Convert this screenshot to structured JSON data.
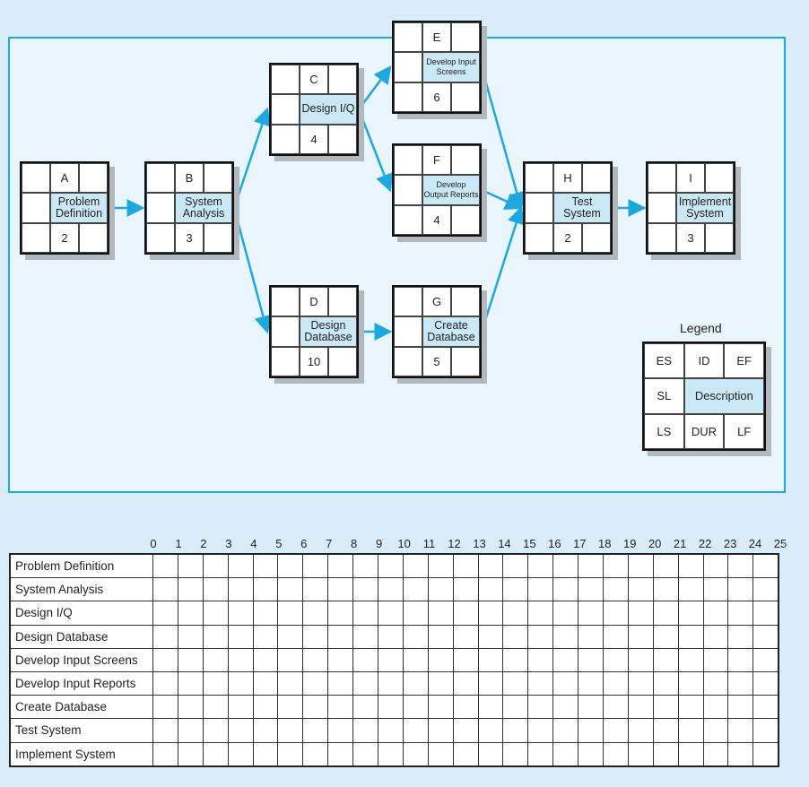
{
  "colors": {
    "accent": "#1ea8e0",
    "description_fill": "#cbe8f7",
    "frame_fill": "#e9f6fd",
    "background": "#d8edf9"
  },
  "nodes": [
    {
      "id": "A",
      "description": "Problem Definition",
      "duration": "2"
    },
    {
      "id": "B",
      "description": "System Analysis",
      "duration": "3"
    },
    {
      "id": "C",
      "description": "Design I/Q",
      "duration": "4"
    },
    {
      "id": "D",
      "description": "Design Database",
      "duration": "10"
    },
    {
      "id": "E",
      "description": "Develop Input Screens",
      "duration": "6"
    },
    {
      "id": "F",
      "description": "Develop Output Reports",
      "duration": "4"
    },
    {
      "id": "G",
      "description": "Create Database",
      "duration": "5"
    },
    {
      "id": "H",
      "description": "Test System",
      "duration": "2"
    },
    {
      "id": "I",
      "description": "Implement System",
      "duration": "3"
    }
  ],
  "edges": [
    [
      "A",
      "B"
    ],
    [
      "B",
      "C"
    ],
    [
      "B",
      "D"
    ],
    [
      "C",
      "E"
    ],
    [
      "C",
      "F"
    ],
    [
      "D",
      "G"
    ],
    [
      "E",
      "H"
    ],
    [
      "F",
      "H"
    ],
    [
      "G",
      "H"
    ],
    [
      "H",
      "I"
    ]
  ],
  "legend": {
    "title": "Legend",
    "es": "ES",
    "id": "ID",
    "ef": "EF",
    "sl": "SL",
    "description": "Description",
    "ls": "LS",
    "dur": "DUR",
    "lf": "LF"
  },
  "gantt": {
    "ticks": [
      "0",
      "1",
      "2",
      "3",
      "4",
      "5",
      "6",
      "7",
      "8",
      "9",
      "10",
      "11",
      "12",
      "13",
      "14",
      "15",
      "16",
      "17",
      "18",
      "19",
      "20",
      "21",
      "22",
      "23",
      "24",
      "25"
    ],
    "rows": [
      "Problem Definition",
      "System Analysis",
      "Design I/Q",
      "Design Database",
      "Develop Input Screens",
      "Develop Input Reports",
      "Create Database",
      "Test System",
      "Implement System"
    ]
  }
}
